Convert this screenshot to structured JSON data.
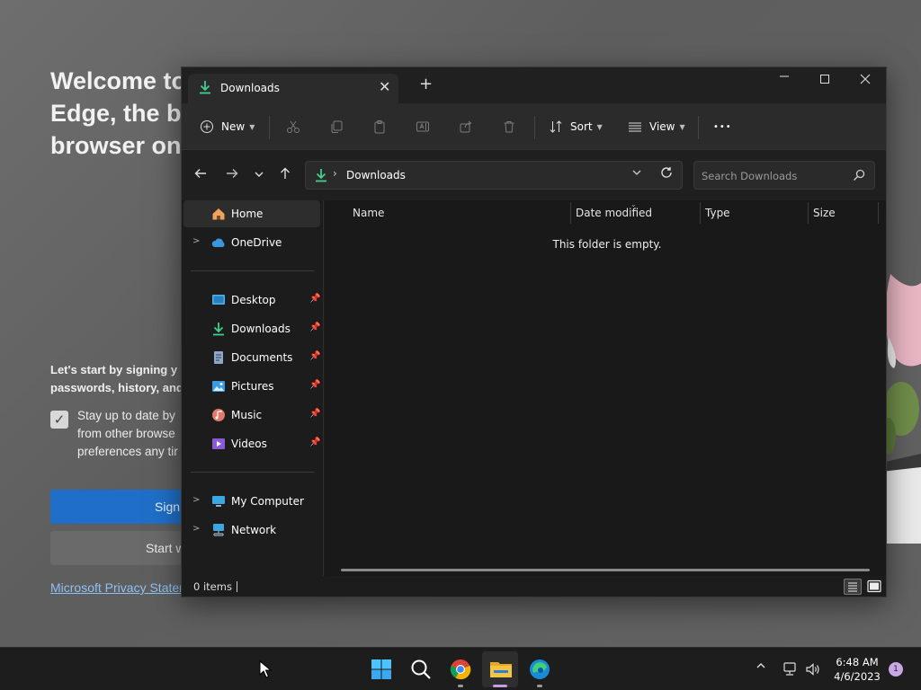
{
  "edge_page": {
    "headline": "Welcome to Microsoft\nEdge, the browser\nbrowser on",
    "headline_visible": "Welcome to\nEdge, the b\nbrowser on",
    "signin_prompt": "Let's start by signing y\npasswords, history, and",
    "sync_text": "Stay up to date by\nfrom other browse\npreferences any tir",
    "signin_button": "Sign",
    "start_button": "Start w",
    "privacy_link": "Microsoft Privacy Stater"
  },
  "explorer": {
    "tab_label": "Downloads",
    "toolbar": {
      "new_label": "New",
      "sort_label": "Sort",
      "view_label": "View",
      "more_label": "•••"
    },
    "address": {
      "path": "Downloads",
      "search_placeholder": "Search Downloads"
    },
    "nav": {
      "items": [
        {
          "label": "Home"
        },
        {
          "label": "OneDrive"
        },
        {
          "label": "Desktop"
        },
        {
          "label": "Downloads"
        },
        {
          "label": "Documents"
        },
        {
          "label": "Pictures"
        },
        {
          "label": "Music"
        },
        {
          "label": "Videos"
        },
        {
          "label": "My Computer"
        },
        {
          "label": "Network"
        }
      ]
    },
    "columns": {
      "name": "Name",
      "date": "Date modified",
      "type": "Type",
      "size": "Size"
    },
    "empty_message": "This folder is empty.",
    "status": {
      "count": "0 items"
    }
  },
  "taskbar": {
    "time": "6:48 AM",
    "date": "4/6/2023",
    "notifications": "1"
  },
  "colors": {
    "accent_green": "#3fcf8e",
    "signin_blue": "#1f6fc8",
    "folder_yellow": "#f4c542"
  }
}
